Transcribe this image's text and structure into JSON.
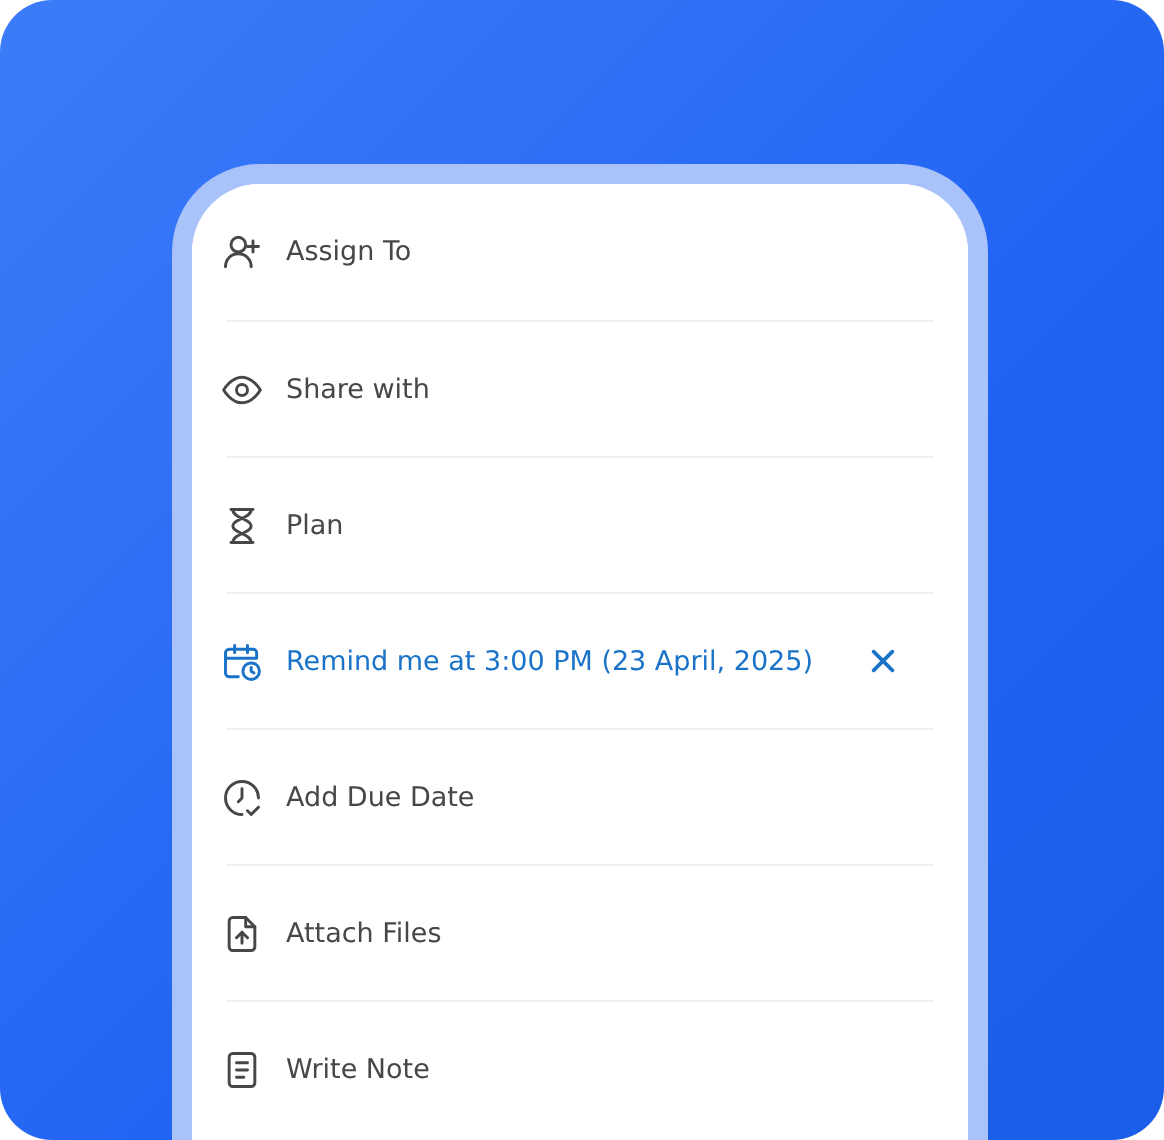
{
  "menu": {
    "items": [
      {
        "kind": "assign",
        "label": "Assign To",
        "active": false
      },
      {
        "kind": "share",
        "label": "Share with",
        "active": false
      },
      {
        "kind": "plan",
        "label": "Plan",
        "active": false
      },
      {
        "kind": "remind",
        "label": "Remind me at 3:00 PM (23 April, 2025)",
        "active": true
      },
      {
        "kind": "due",
        "label": "Add Due Date",
        "active": false
      },
      {
        "kind": "attach",
        "label": "Attach Files",
        "active": false
      },
      {
        "kind": "note",
        "label": "Write Note",
        "active": false
      }
    ]
  }
}
